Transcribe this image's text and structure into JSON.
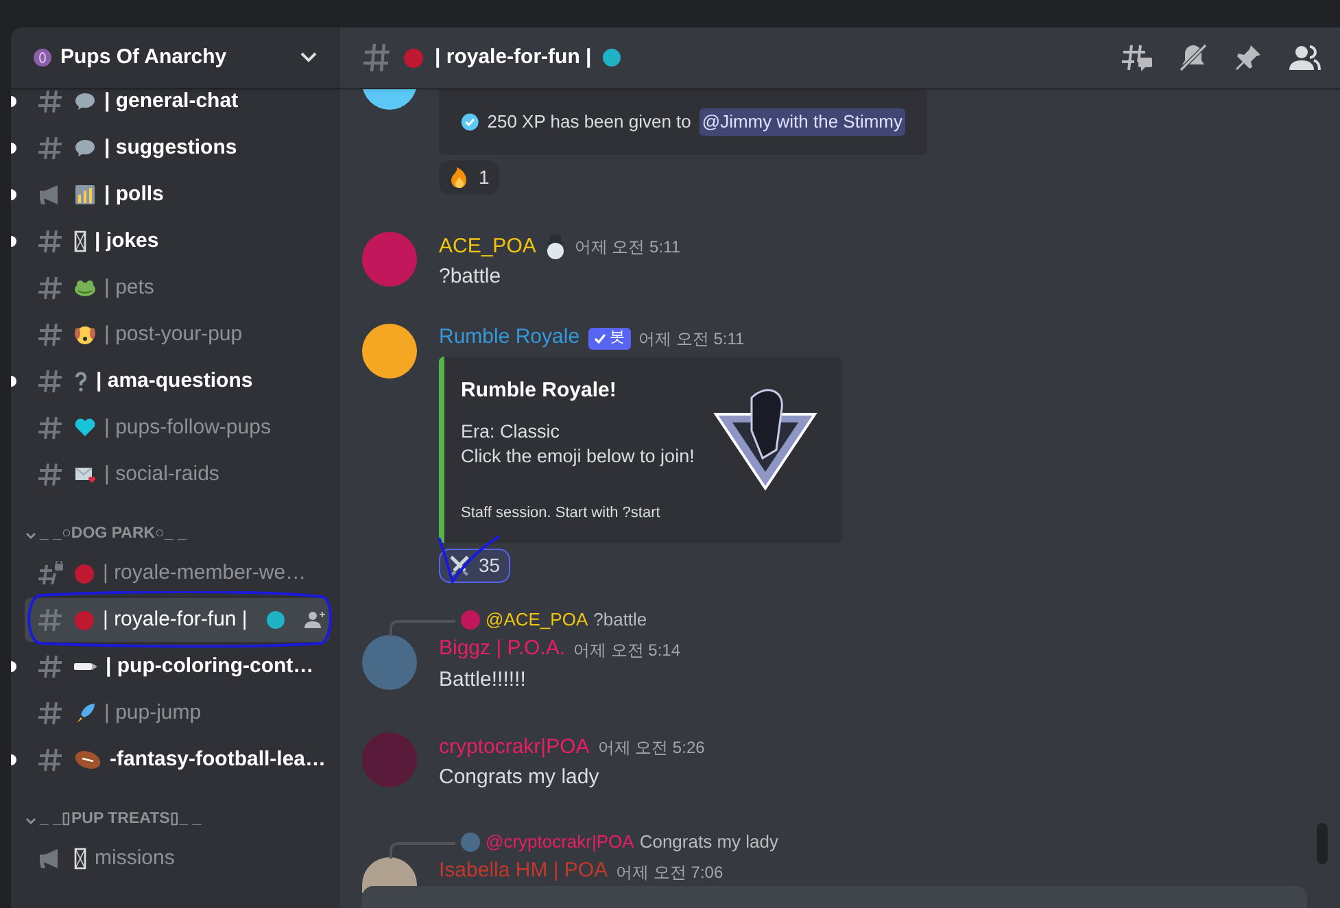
{
  "server": {
    "name": "Pups Of Anarchy"
  },
  "channel_groups": [
    {
      "channels": [
        {
          "kind": "text",
          "name": "| general-chat",
          "unread": true,
          "selected": false
        },
        {
          "kind": "text",
          "name": "| suggestions",
          "unread": true,
          "selected": false
        },
        {
          "kind": "announcement",
          "name": "| polls",
          "unread": true,
          "selected": false
        },
        {
          "kind": "text",
          "name": "| jokes",
          "unread": true,
          "selected": false
        },
        {
          "kind": "text",
          "name": "| pets",
          "unread": false,
          "selected": false
        },
        {
          "kind": "text",
          "name": "| post-your-pup",
          "unread": false,
          "selected": false
        },
        {
          "kind": "text",
          "name": "| ama-questions",
          "unread": true,
          "selected": false
        },
        {
          "kind": "text",
          "name": "| pups-follow-pups",
          "unread": false,
          "selected": false
        },
        {
          "kind": "text",
          "name": "| social-raids",
          "unread": false,
          "selected": false
        }
      ]
    },
    {
      "category": "_ _○DOG PARK○_ _",
      "expanded": true,
      "channels": [
        {
          "kind": "locked",
          "name": "| royale-member-we…",
          "unread": false,
          "selected": false
        },
        {
          "kind": "text",
          "name": "| royale-for-fun |",
          "unread": false,
          "selected": true
        },
        {
          "kind": "text",
          "name": "| pup-coloring-cont…",
          "unread": true,
          "selected": false
        },
        {
          "kind": "text",
          "name": "| pup-jump",
          "unread": false,
          "selected": false
        },
        {
          "kind": "text",
          "name": "-fantasy-football-lea…",
          "unread": true,
          "selected": false
        }
      ]
    },
    {
      "category": "_ _▯PUP TREATS▯_ _",
      "expanded": true,
      "channels": [
        {
          "kind": "announcement",
          "name": "missions",
          "unread": false,
          "selected": false
        }
      ]
    }
  ],
  "header": {
    "channel": "| royale-for-fun |"
  },
  "messages": [
    {
      "kind": "partial-embed",
      "text": "250 XP has been given to",
      "mention": "@Jimmy with the Stimmy",
      "reactions": [
        {
          "count": "1",
          "selected": false
        }
      ]
    },
    {
      "kind": "message",
      "author": "ACE_POA",
      "color": "#f1c40f",
      "time": "어제 오전 5:11",
      "text": "?battle"
    },
    {
      "kind": "bot-embed",
      "author": "Rumble Royale",
      "color": "#3498db",
      "bot_label": "봇",
      "time": "어제 오전 5:11",
      "embed": {
        "title": "Rumble Royale!",
        "lines": [
          "Era: Classic",
          "Click the emoji below to join!"
        ],
        "footer": "Staff session. Start with ?start"
      },
      "reactions": [
        {
          "count": "35",
          "selected": true
        }
      ]
    },
    {
      "kind": "reply",
      "reply": {
        "to": "@ACE_POA",
        "color": "#f1c40f",
        "text": "?battle"
      },
      "author": "Biggz | P.O.A.",
      "color": "#e91e63",
      "time": "어제 오전 5:14",
      "text": "Battle!!!!!!"
    },
    {
      "kind": "message",
      "author": "cryptocrakr|POA",
      "color": "#e91e63",
      "time": "어제 오전 5:26",
      "text": "Congrats my lady"
    },
    {
      "kind": "reply",
      "reply": {
        "to": "@cryptocrakr|POA",
        "color": "#e91e63",
        "text": "Congrats my lady"
      },
      "author": "Isabella HM | POA",
      "color": "#c0392b",
      "time": "어제 오전 7:06"
    }
  ]
}
